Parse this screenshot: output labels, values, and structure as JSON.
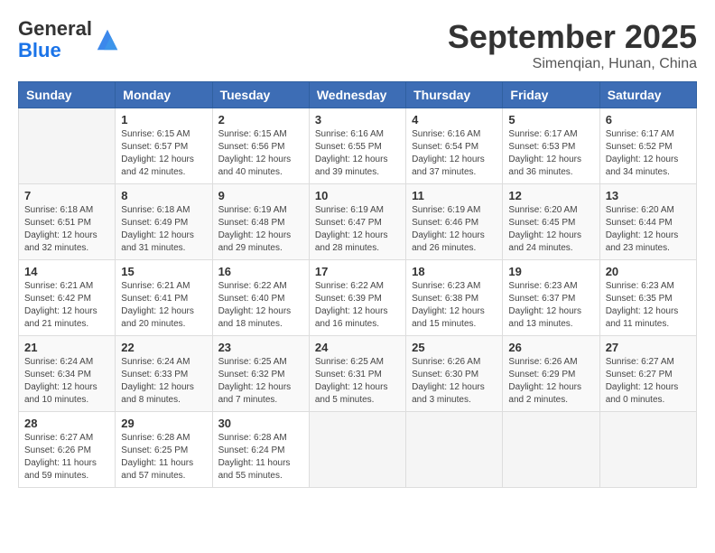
{
  "header": {
    "logo_general": "General",
    "logo_blue": "Blue",
    "month_title": "September 2025",
    "subtitle": "Simenqian, Hunan, China"
  },
  "weekdays": [
    "Sunday",
    "Monday",
    "Tuesday",
    "Wednesday",
    "Thursday",
    "Friday",
    "Saturday"
  ],
  "weeks": [
    [
      {
        "day": "",
        "info": ""
      },
      {
        "day": "1",
        "info": "Sunrise: 6:15 AM\nSunset: 6:57 PM\nDaylight: 12 hours\nand 42 minutes."
      },
      {
        "day": "2",
        "info": "Sunrise: 6:15 AM\nSunset: 6:56 PM\nDaylight: 12 hours\nand 40 minutes."
      },
      {
        "day": "3",
        "info": "Sunrise: 6:16 AM\nSunset: 6:55 PM\nDaylight: 12 hours\nand 39 minutes."
      },
      {
        "day": "4",
        "info": "Sunrise: 6:16 AM\nSunset: 6:54 PM\nDaylight: 12 hours\nand 37 minutes."
      },
      {
        "day": "5",
        "info": "Sunrise: 6:17 AM\nSunset: 6:53 PM\nDaylight: 12 hours\nand 36 minutes."
      },
      {
        "day": "6",
        "info": "Sunrise: 6:17 AM\nSunset: 6:52 PM\nDaylight: 12 hours\nand 34 minutes."
      }
    ],
    [
      {
        "day": "7",
        "info": "Sunrise: 6:18 AM\nSunset: 6:51 PM\nDaylight: 12 hours\nand 32 minutes."
      },
      {
        "day": "8",
        "info": "Sunrise: 6:18 AM\nSunset: 6:49 PM\nDaylight: 12 hours\nand 31 minutes."
      },
      {
        "day": "9",
        "info": "Sunrise: 6:19 AM\nSunset: 6:48 PM\nDaylight: 12 hours\nand 29 minutes."
      },
      {
        "day": "10",
        "info": "Sunrise: 6:19 AM\nSunset: 6:47 PM\nDaylight: 12 hours\nand 28 minutes."
      },
      {
        "day": "11",
        "info": "Sunrise: 6:19 AM\nSunset: 6:46 PM\nDaylight: 12 hours\nand 26 minutes."
      },
      {
        "day": "12",
        "info": "Sunrise: 6:20 AM\nSunset: 6:45 PM\nDaylight: 12 hours\nand 24 minutes."
      },
      {
        "day": "13",
        "info": "Sunrise: 6:20 AM\nSunset: 6:44 PM\nDaylight: 12 hours\nand 23 minutes."
      }
    ],
    [
      {
        "day": "14",
        "info": "Sunrise: 6:21 AM\nSunset: 6:42 PM\nDaylight: 12 hours\nand 21 minutes."
      },
      {
        "day": "15",
        "info": "Sunrise: 6:21 AM\nSunset: 6:41 PM\nDaylight: 12 hours\nand 20 minutes."
      },
      {
        "day": "16",
        "info": "Sunrise: 6:22 AM\nSunset: 6:40 PM\nDaylight: 12 hours\nand 18 minutes."
      },
      {
        "day": "17",
        "info": "Sunrise: 6:22 AM\nSunset: 6:39 PM\nDaylight: 12 hours\nand 16 minutes."
      },
      {
        "day": "18",
        "info": "Sunrise: 6:23 AM\nSunset: 6:38 PM\nDaylight: 12 hours\nand 15 minutes."
      },
      {
        "day": "19",
        "info": "Sunrise: 6:23 AM\nSunset: 6:37 PM\nDaylight: 12 hours\nand 13 minutes."
      },
      {
        "day": "20",
        "info": "Sunrise: 6:23 AM\nSunset: 6:35 PM\nDaylight: 12 hours\nand 11 minutes."
      }
    ],
    [
      {
        "day": "21",
        "info": "Sunrise: 6:24 AM\nSunset: 6:34 PM\nDaylight: 12 hours\nand 10 minutes."
      },
      {
        "day": "22",
        "info": "Sunrise: 6:24 AM\nSunset: 6:33 PM\nDaylight: 12 hours\nand 8 minutes."
      },
      {
        "day": "23",
        "info": "Sunrise: 6:25 AM\nSunset: 6:32 PM\nDaylight: 12 hours\nand 7 minutes."
      },
      {
        "day": "24",
        "info": "Sunrise: 6:25 AM\nSunset: 6:31 PM\nDaylight: 12 hours\nand 5 minutes."
      },
      {
        "day": "25",
        "info": "Sunrise: 6:26 AM\nSunset: 6:30 PM\nDaylight: 12 hours\nand 3 minutes."
      },
      {
        "day": "26",
        "info": "Sunrise: 6:26 AM\nSunset: 6:29 PM\nDaylight: 12 hours\nand 2 minutes."
      },
      {
        "day": "27",
        "info": "Sunrise: 6:27 AM\nSunset: 6:27 PM\nDaylight: 12 hours\nand 0 minutes."
      }
    ],
    [
      {
        "day": "28",
        "info": "Sunrise: 6:27 AM\nSunset: 6:26 PM\nDaylight: 11 hours\nand 59 minutes."
      },
      {
        "day": "29",
        "info": "Sunrise: 6:28 AM\nSunset: 6:25 PM\nDaylight: 11 hours\nand 57 minutes."
      },
      {
        "day": "30",
        "info": "Sunrise: 6:28 AM\nSunset: 6:24 PM\nDaylight: 11 hours\nand 55 minutes."
      },
      {
        "day": "",
        "info": ""
      },
      {
        "day": "",
        "info": ""
      },
      {
        "day": "",
        "info": ""
      },
      {
        "day": "",
        "info": ""
      }
    ]
  ]
}
